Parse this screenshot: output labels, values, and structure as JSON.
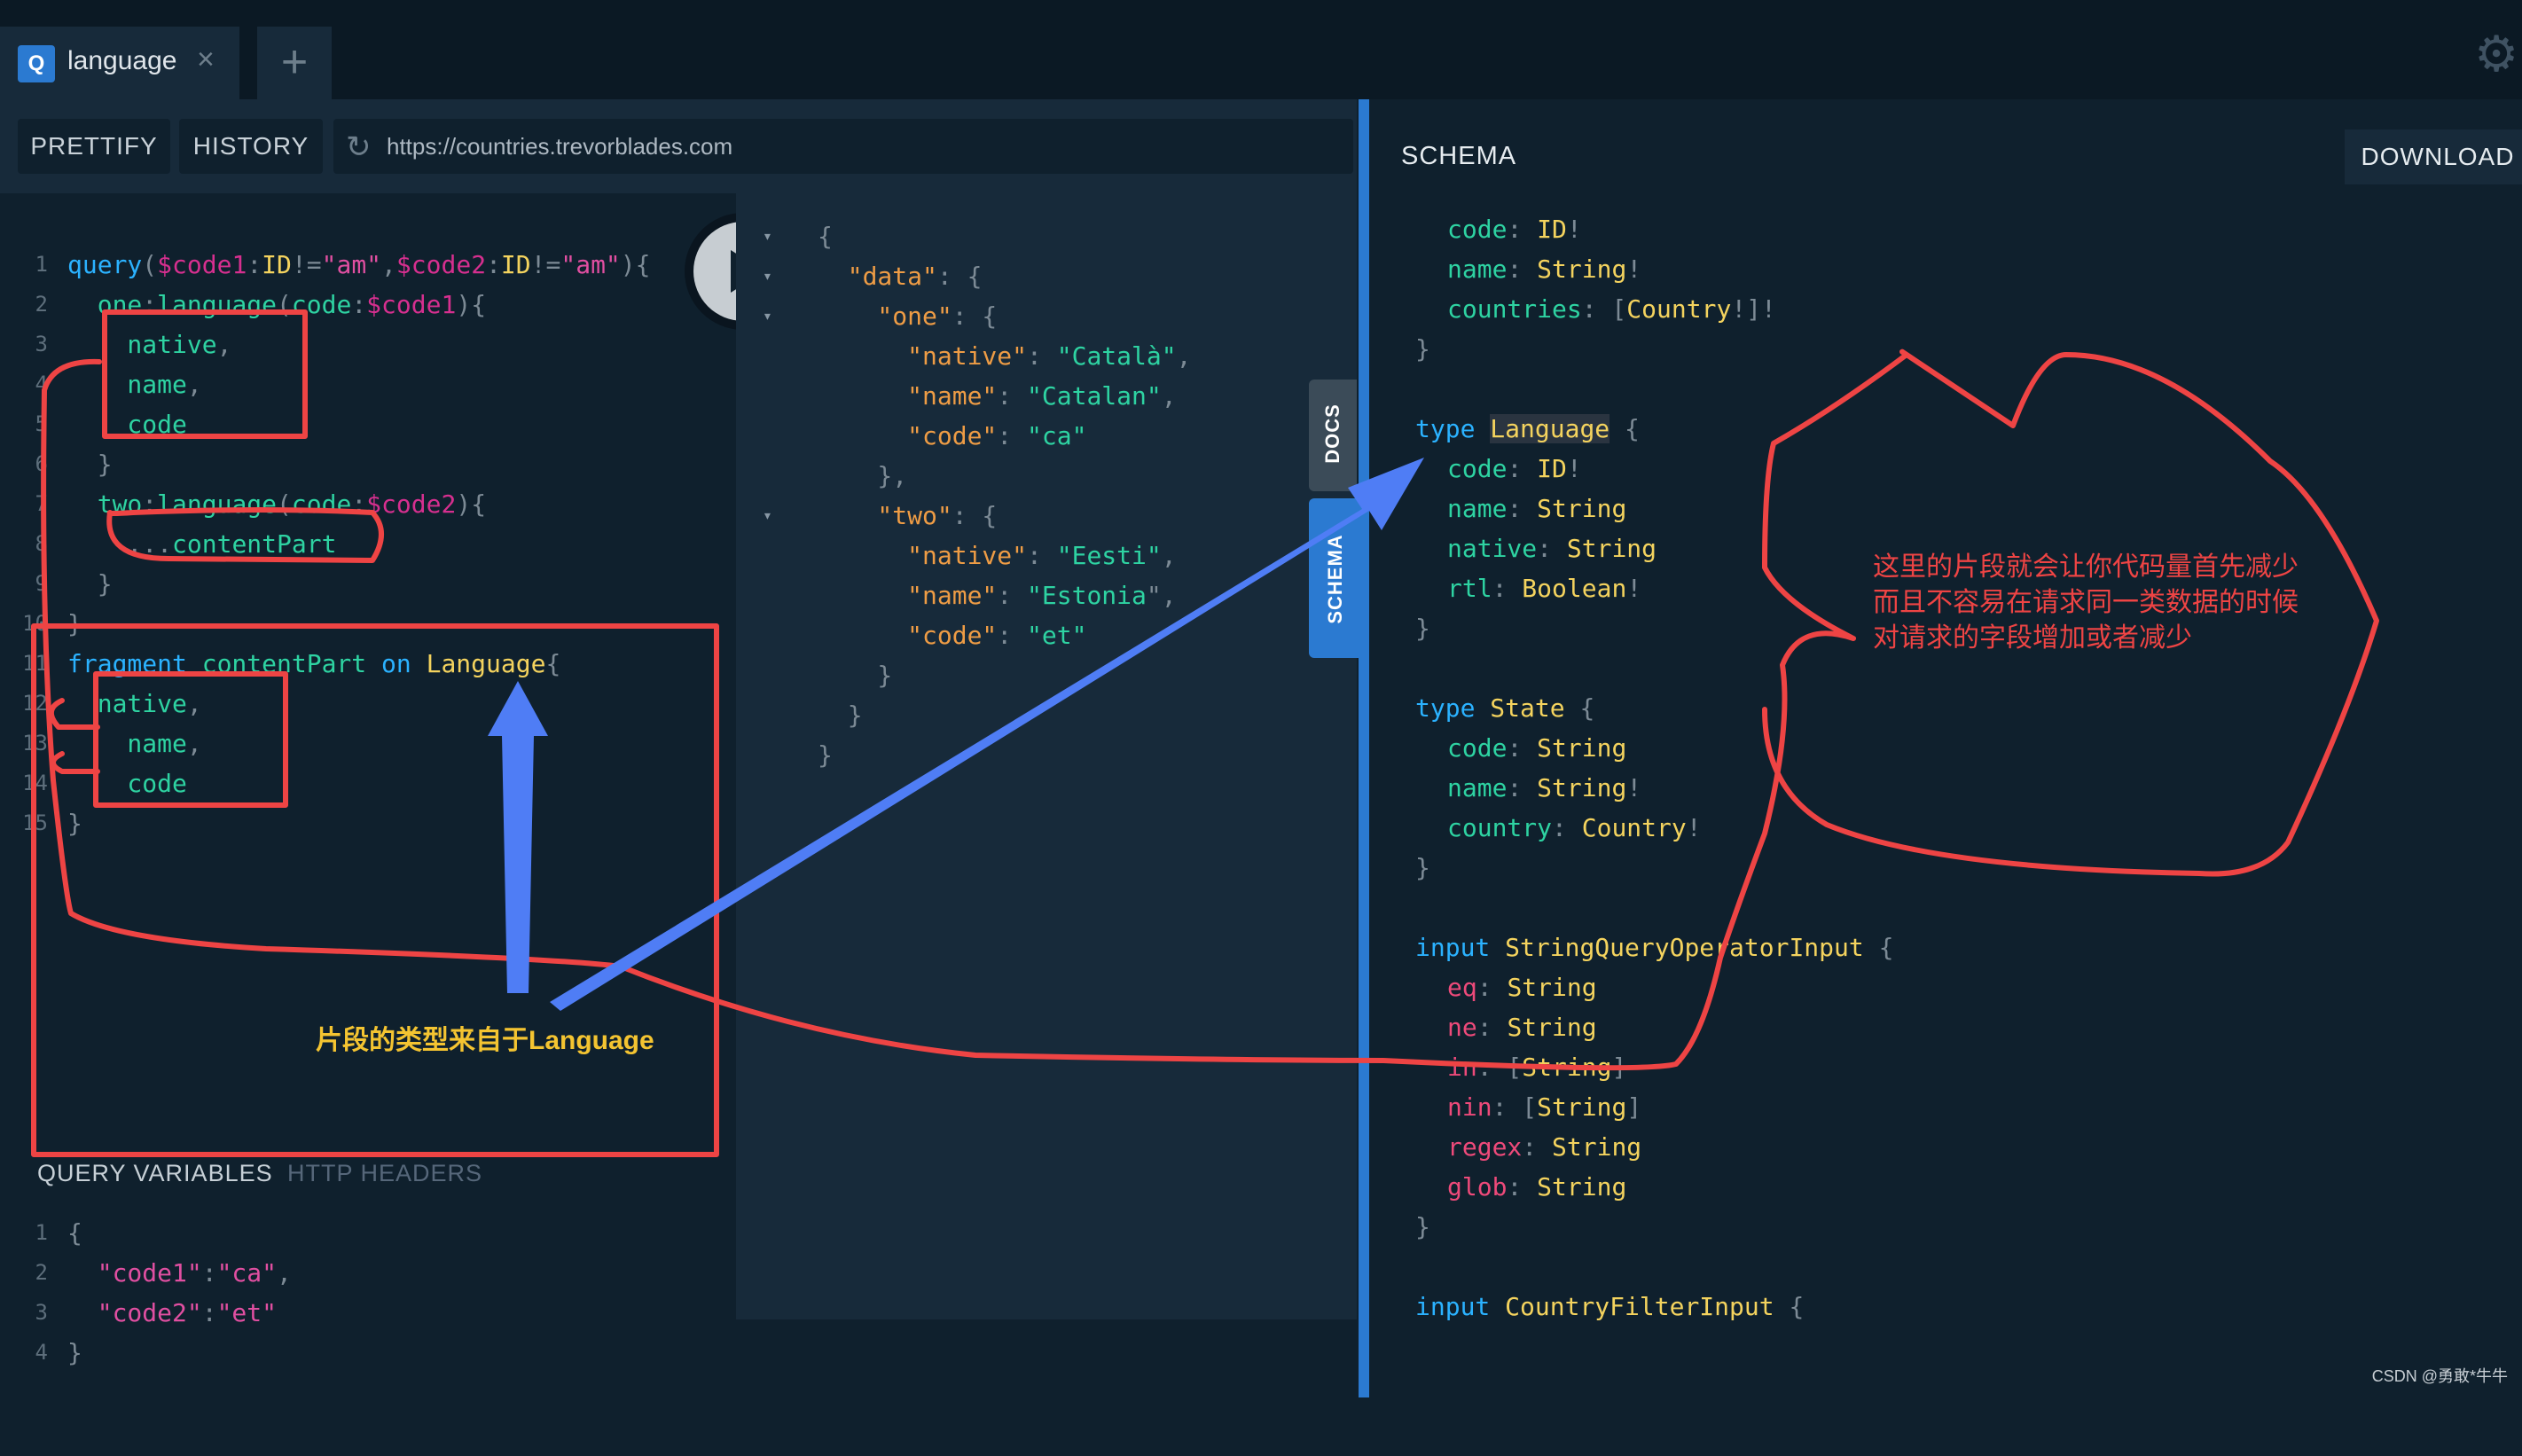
{
  "tab": {
    "icon_letter": "Q",
    "label": "language",
    "close": "×",
    "add": "+"
  },
  "toolbar": {
    "prettify": "PRETTIFY",
    "history": "HISTORY",
    "url": "https://countries.trevorblades.com"
  },
  "editor": {
    "lines": [
      {
        "n": "1",
        "tokens": [
          [
            "kw",
            "query"
          ],
          [
            "punc",
            "("
          ],
          [
            "var",
            "$code1"
          ],
          [
            "punc",
            ":"
          ],
          [
            "type",
            "ID"
          ],
          [
            "punc",
            "!="
          ],
          [
            "str",
            "\"am\""
          ],
          [
            "punc",
            ","
          ],
          [
            "var",
            "$code2"
          ],
          [
            "punc",
            ":"
          ],
          [
            "type",
            "ID"
          ],
          [
            "punc",
            "!="
          ],
          [
            "str",
            "\"am\""
          ],
          [
            "punc",
            ")"
          ],
          [
            "punc",
            "{"
          ]
        ]
      },
      {
        "n": "2",
        "tokens": [
          [
            "field",
            "  one"
          ],
          [
            "punc",
            ":"
          ],
          [
            "field",
            "language"
          ],
          [
            "punc",
            "("
          ],
          [
            "field",
            "code"
          ],
          [
            "punc",
            ":"
          ],
          [
            "var",
            "$code1"
          ],
          [
            "punc",
            ")"
          ],
          [
            "punc",
            "{"
          ]
        ]
      },
      {
        "n": "3",
        "tokens": [
          [
            "field",
            "    native"
          ],
          [
            "punc",
            ","
          ]
        ]
      },
      {
        "n": "4",
        "tokens": [
          [
            "field",
            "    name"
          ],
          [
            "punc",
            ","
          ]
        ]
      },
      {
        "n": "5",
        "tokens": [
          [
            "field",
            "    code"
          ]
        ]
      },
      {
        "n": "6",
        "tokens": [
          [
            "punc",
            "  }"
          ]
        ]
      },
      {
        "n": "7",
        "tokens": [
          [
            "field",
            "  two"
          ],
          [
            "punc",
            ":"
          ],
          [
            "field",
            "language"
          ],
          [
            "punc",
            "("
          ],
          [
            "field",
            "code"
          ],
          [
            "punc",
            ":"
          ],
          [
            "var",
            "$code2"
          ],
          [
            "punc",
            ")"
          ],
          [
            "punc",
            "{"
          ]
        ]
      },
      {
        "n": "8",
        "tokens": [
          [
            "punc",
            "    ..."
          ],
          [
            "field",
            "contentPart"
          ]
        ]
      },
      {
        "n": "9",
        "tokens": [
          [
            "punc",
            "  }"
          ]
        ]
      },
      {
        "n": "10",
        "tokens": [
          [
            "punc",
            "}"
          ]
        ]
      },
      {
        "n": "11",
        "tokens": [
          [
            "kw",
            "fragment"
          ],
          [
            "plain",
            " "
          ],
          [
            "field",
            "contentPart"
          ],
          [
            "plain",
            " "
          ],
          [
            "kw",
            "on"
          ],
          [
            "plain",
            " "
          ],
          [
            "type",
            "Language"
          ],
          [
            "punc",
            "{"
          ]
        ]
      },
      {
        "n": "12",
        "tokens": [
          [
            "field",
            "  native"
          ],
          [
            "punc",
            ","
          ]
        ]
      },
      {
        "n": "13",
        "tokens": [
          [
            "field",
            "    name"
          ],
          [
            "punc",
            ","
          ]
        ]
      },
      {
        "n": "14",
        "tokens": [
          [
            "field",
            "    code"
          ]
        ]
      },
      {
        "n": "15",
        "tokens": [
          [
            "punc",
            "}"
          ]
        ]
      }
    ],
    "run_label": "Execute Query"
  },
  "variables": {
    "tab_vars": "QUERY VARIABLES",
    "tab_headers": "HTTP HEADERS",
    "lines": [
      {
        "n": "1",
        "tokens": [
          [
            "punc",
            "{"
          ]
        ]
      },
      {
        "n": "2",
        "tokens": [
          [
            "str",
            "  \"code1\""
          ],
          [
            "punc",
            ":"
          ],
          [
            "str",
            "\"ca\""
          ],
          [
            "punc",
            ","
          ]
        ]
      },
      {
        "n": "3",
        "tokens": [
          [
            "str",
            "  \"code2\""
          ],
          [
            "punc",
            ":"
          ],
          [
            "str",
            "\"et\""
          ]
        ]
      },
      {
        "n": "4",
        "tokens": [
          [
            "punc",
            "}"
          ]
        ]
      }
    ]
  },
  "result": {
    "lines": [
      {
        "arrow": "▾",
        "tokens": [
          [
            "punc",
            "{"
          ]
        ]
      },
      {
        "arrow": "▾",
        "tokens": [
          [
            "jkey",
            "  \"data\""
          ],
          [
            "punc",
            ": {"
          ]
        ]
      },
      {
        "arrow": "▾",
        "tokens": [
          [
            "jkey",
            "    \"one\""
          ],
          [
            "punc",
            ": {"
          ]
        ]
      },
      {
        "arrow": "",
        "tokens": [
          [
            "jkey",
            "      \"native\""
          ],
          [
            "punc",
            ": "
          ],
          [
            "jstr",
            "\"Català\""
          ],
          [
            "punc",
            ","
          ]
        ]
      },
      {
        "arrow": "",
        "tokens": [
          [
            "jkey",
            "      \"name\""
          ],
          [
            "punc",
            ": "
          ],
          [
            "jstr",
            "\"Catalan\""
          ],
          [
            "punc",
            ","
          ]
        ]
      },
      {
        "arrow": "",
        "tokens": [
          [
            "jkey",
            "      \"code\""
          ],
          [
            "punc",
            ": "
          ],
          [
            "jstr",
            "\"ca\""
          ]
        ]
      },
      {
        "arrow": "",
        "tokens": [
          [
            "punc",
            "    },"
          ]
        ]
      },
      {
        "arrow": "▾",
        "tokens": [
          [
            "jkey",
            "    \"two\""
          ],
          [
            "punc",
            ": {"
          ]
        ]
      },
      {
        "arrow": "",
        "tokens": [
          [
            "jkey",
            "      \"native\""
          ],
          [
            "punc",
            ": "
          ],
          [
            "jstr",
            "\"Eesti\""
          ],
          [
            "punc",
            ","
          ]
        ]
      },
      {
        "arrow": "",
        "tokens": [
          [
            "jkey",
            "      \"name\""
          ],
          [
            "punc",
            ": "
          ],
          [
            "jstr",
            "\"Estonia"
          ],
          [
            "punc",
            "\","
          ]
        ]
      },
      {
        "arrow": "",
        "tokens": [
          [
            "jkey",
            "      \"code\""
          ],
          [
            "punc",
            ": "
          ],
          [
            "jstr",
            "\"et\""
          ]
        ]
      },
      {
        "arrow": "",
        "tokens": [
          [
            "punc",
            "    }"
          ]
        ]
      },
      {
        "arrow": "",
        "tokens": [
          [
            "punc",
            "  }"
          ]
        ]
      },
      {
        "arrow": "",
        "tokens": [
          [
            "punc",
            "}"
          ]
        ]
      }
    ]
  },
  "side_tabs": {
    "docs": "DOCS",
    "schema": "SCHEMA"
  },
  "schema": {
    "title": "SCHEMA",
    "download": "DOWNLOAD",
    "lines": [
      {
        "ind": true,
        "tokens": [
          [
            "sf",
            "code"
          ],
          [
            "sp",
            ": "
          ],
          [
            "st",
            "ID"
          ],
          [
            "sp",
            "!"
          ]
        ]
      },
      {
        "ind": true,
        "tokens": [
          [
            "sf",
            "name"
          ],
          [
            "sp",
            ": "
          ],
          [
            "st",
            "String"
          ],
          [
            "sp",
            "!"
          ]
        ]
      },
      {
        "ind": true,
        "tokens": [
          [
            "sf",
            "countries"
          ],
          [
            "sp",
            ": ["
          ],
          [
            "st",
            "Country"
          ],
          [
            "sp",
            "!]!"
          ]
        ]
      },
      {
        "ind": false,
        "tokens": [
          [
            "sp",
            "}"
          ]
        ]
      },
      {
        "ind": false,
        "tokens": []
      },
      {
        "ind": false,
        "tokens": [
          [
            "sk",
            "type"
          ],
          [
            "sp",
            " "
          ],
          [
            "st hl",
            "Language"
          ],
          [
            "sp",
            " {"
          ]
        ]
      },
      {
        "ind": true,
        "tokens": [
          [
            "sf",
            "code"
          ],
          [
            "sp",
            ": "
          ],
          [
            "st",
            "ID"
          ],
          [
            "sp",
            "!"
          ]
        ]
      },
      {
        "ind": true,
        "tokens": [
          [
            "sf",
            "name"
          ],
          [
            "sp",
            ": "
          ],
          [
            "st",
            "String"
          ]
        ]
      },
      {
        "ind": true,
        "tokens": [
          [
            "sf",
            "native"
          ],
          [
            "sp",
            ": "
          ],
          [
            "st",
            "String"
          ]
        ]
      },
      {
        "ind": true,
        "tokens": [
          [
            "sf",
            "rtl"
          ],
          [
            "sp",
            ": "
          ],
          [
            "st",
            "Boolean"
          ],
          [
            "sp",
            "!"
          ]
        ]
      },
      {
        "ind": false,
        "tokens": [
          [
            "sp",
            "}"
          ]
        ]
      },
      {
        "ind": false,
        "tokens": []
      },
      {
        "ind": false,
        "tokens": [
          [
            "sk",
            "type"
          ],
          [
            "sp",
            " "
          ],
          [
            "st",
            "State"
          ],
          [
            "sp",
            " {"
          ]
        ]
      },
      {
        "ind": true,
        "tokens": [
          [
            "sf",
            "code"
          ],
          [
            "sp",
            ": "
          ],
          [
            "st",
            "String"
          ]
        ]
      },
      {
        "ind": true,
        "tokens": [
          [
            "sf",
            "name"
          ],
          [
            "sp",
            ": "
          ],
          [
            "st",
            "String"
          ],
          [
            "sp",
            "!"
          ]
        ]
      },
      {
        "ind": true,
        "tokens": [
          [
            "sf",
            "country"
          ],
          [
            "sp",
            ": "
          ],
          [
            "st",
            "Country"
          ],
          [
            "sp",
            "!"
          ]
        ]
      },
      {
        "ind": false,
        "tokens": [
          [
            "sp",
            "}"
          ]
        ]
      },
      {
        "ind": false,
        "tokens": []
      },
      {
        "ind": false,
        "tokens": [
          [
            "sk",
            "input"
          ],
          [
            "sp",
            " "
          ],
          [
            "st",
            "StringQueryOperatorInput"
          ],
          [
            "sp",
            " {"
          ]
        ]
      },
      {
        "ind": true,
        "tokens": [
          [
            "sa",
            "eq"
          ],
          [
            "sp",
            ": "
          ],
          [
            "st",
            "String"
          ]
        ]
      },
      {
        "ind": true,
        "tokens": [
          [
            "sa",
            "ne"
          ],
          [
            "sp",
            ": "
          ],
          [
            "st",
            "String"
          ]
        ]
      },
      {
        "ind": true,
        "tokens": [
          [
            "sa",
            "in"
          ],
          [
            "sp",
            ": ["
          ],
          [
            "st",
            "String"
          ],
          [
            "sp",
            "]"
          ]
        ]
      },
      {
        "ind": true,
        "tokens": [
          [
            "sa",
            "nin"
          ],
          [
            "sp",
            ": ["
          ],
          [
            "st",
            "String"
          ],
          [
            "sp",
            "]"
          ]
        ]
      },
      {
        "ind": true,
        "tokens": [
          [
            "sa",
            "regex"
          ],
          [
            "sp",
            ": "
          ],
          [
            "st",
            "String"
          ]
        ]
      },
      {
        "ind": true,
        "tokens": [
          [
            "sa",
            "glob"
          ],
          [
            "sp",
            ": "
          ],
          [
            "st",
            "String"
          ]
        ]
      },
      {
        "ind": false,
        "tokens": [
          [
            "sp",
            "}"
          ]
        ]
      },
      {
        "ind": false,
        "tokens": []
      },
      {
        "ind": false,
        "tokens": [
          [
            "sk",
            "input"
          ],
          [
            "sp",
            " "
          ],
          [
            "st",
            "CountryFilterInput"
          ],
          [
            "sp",
            " {"
          ]
        ]
      }
    ]
  },
  "annotations": {
    "yellow_note": "片段的类型来自于Language",
    "red_note_lines": [
      "这里的片段就会让你代码量首先减少",
      "而且不容易在请求同一类数据的时候",
      "对请求的字段增加或者减少"
    ],
    "red": "#ee4444",
    "blue": "#4f7df5",
    "yellow": "#f4c431"
  },
  "watermark": "CSDN @勇敢*牛牛"
}
